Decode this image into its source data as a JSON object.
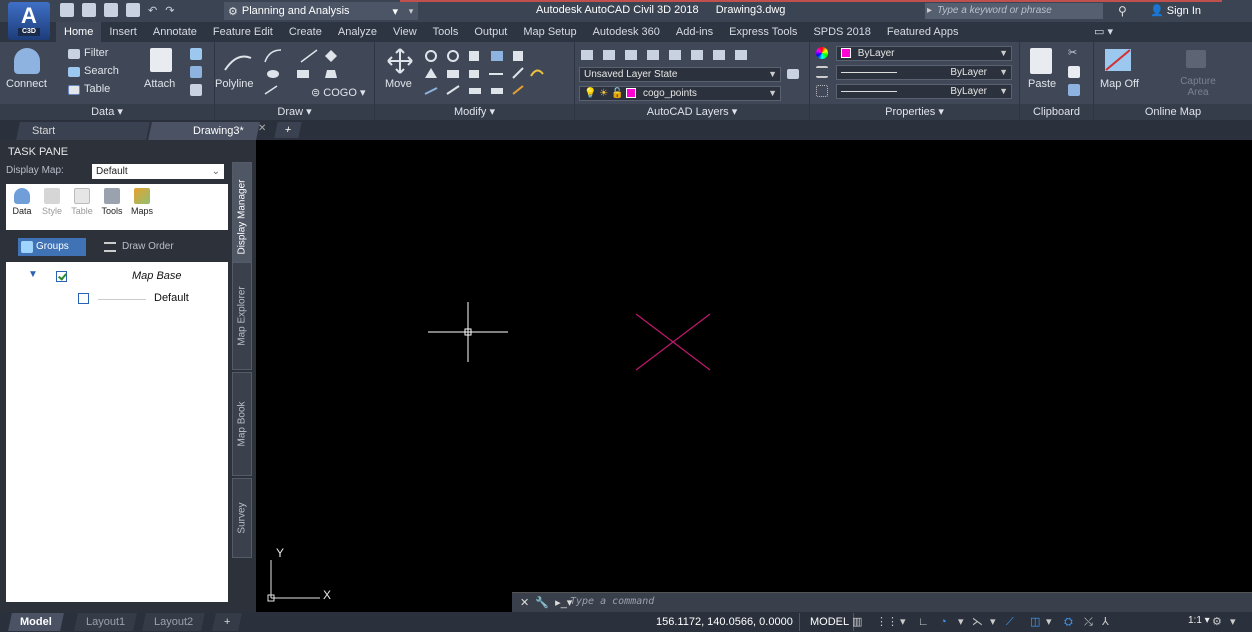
{
  "app": {
    "logo_text": "A",
    "logo_sub": "C3D",
    "title_app": "Autodesk AutoCAD Civil 3D 2018",
    "title_file": "Drawing3.dwg",
    "workspace": "Planning and Analysis",
    "search_placeholder": "Type a keyword or phrase",
    "signin": "Sign In"
  },
  "ribbon_tabs": [
    "Home",
    "Insert",
    "Annotate",
    "Feature Edit",
    "Create",
    "Analyze",
    "View",
    "Tools",
    "Output",
    "Map Setup",
    "Autodesk 360",
    "Add-ins",
    "Express Tools",
    "SPDS 2018",
    "Featured Apps"
  ],
  "ribbon": {
    "data": {
      "title": "Data ▾",
      "connect": "Connect",
      "filter": "Filter",
      "search": "Search",
      "table": "Table",
      "attach": "Attach"
    },
    "draw": {
      "title": "Draw ▾",
      "polyline": "Polyline",
      "cogo": "COGO"
    },
    "modify": {
      "title": "Modify ▾",
      "move": "Move"
    },
    "layers": {
      "title": "AutoCAD Layers ▾",
      "layer_state": "Unsaved Layer State",
      "current_layer": "cogo_points"
    },
    "properties": {
      "title": "Properties ▾",
      "color": "ByLayer",
      "linetype": "ByLayer",
      "lineweight": "ByLayer"
    },
    "clipboard": {
      "title": "Clipboard",
      "paste": "Paste"
    },
    "online_map": {
      "title": "Online Map",
      "map_off": "Map Off",
      "capture_area": "Capture Area"
    }
  },
  "doc_tabs": {
    "start": "Start",
    "drawing": "Drawing3*"
  },
  "task_pane": {
    "title": "TASK PANE",
    "display_map_label": "Display Map:",
    "display_map_value": "Default",
    "tools": [
      "Data",
      "Style",
      "Table",
      "Tools",
      "Maps"
    ],
    "groups": "Groups",
    "draw_order": "Draw Order",
    "tree": {
      "group": "Map Base",
      "item": "Default"
    },
    "side_tabs": [
      "Display Manager",
      "Map Explorer",
      "Map Book",
      "Survey"
    ]
  },
  "canvas": {
    "ucs_y": "Y",
    "ucs_x": "X"
  },
  "command": {
    "placeholder": "Type a command"
  },
  "status": {
    "layouts": [
      "Model",
      "Layout1",
      "Layout2"
    ],
    "coords": "156.1172, 140.0566, 0.0000",
    "model": "MODEL",
    "scale": "1:1"
  },
  "colors": {
    "accent": "#3f73b6",
    "layer_color": "#ff00d4",
    "crosshair": "#ffffff",
    "point_marker": "#c0186e"
  }
}
